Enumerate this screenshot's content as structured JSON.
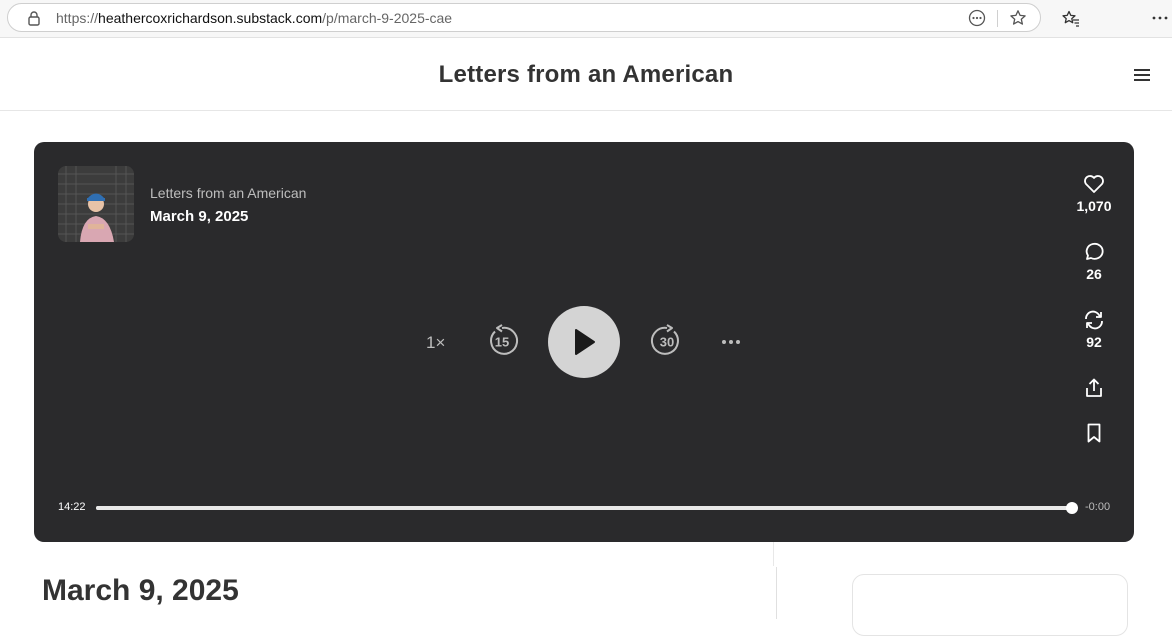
{
  "browser": {
    "url_prefix": "https://",
    "url_host": "heathercoxrichardson.substack.com",
    "url_path": "/p/march-9-2025-cae",
    "icons": [
      "lock-icon",
      "more-circle-icon",
      "star-icon",
      "favorites-icon",
      "more-horizontal-icon"
    ]
  },
  "site": {
    "title": "Letters from an American",
    "menu_icon": "hamburger-icon"
  },
  "player": {
    "show_name": "Letters from an American",
    "episode_title": "March 9, 2025",
    "speed": "1×",
    "skip_back": "15",
    "skip_forward": "30",
    "likes": "1,070",
    "comments": "26",
    "restacks": "92",
    "time_elapsed": "14:22",
    "time_remaining": "-0:00",
    "progress": 1.0,
    "colors": {
      "background": "#2a2a2c",
      "play_button": "#d4d4d4"
    }
  },
  "post": {
    "title": "March 9, 2025"
  }
}
